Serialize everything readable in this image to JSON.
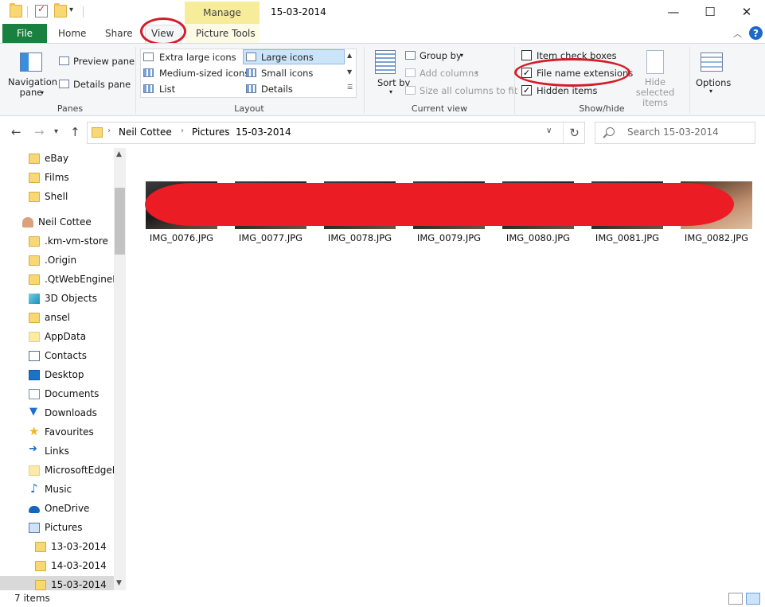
{
  "window": {
    "title": "15-03-2014",
    "contextual_tab_group": "Manage",
    "minimize_glyph": "—",
    "maximize_glyph": "☐",
    "close_glyph": "✕"
  },
  "ribbon_tabs": {
    "file": "File",
    "home": "Home",
    "share": "Share",
    "view": "View",
    "picture_tools": "Picture Tools",
    "active": "View"
  },
  "ribbon": {
    "panes": {
      "label": "Panes",
      "navigation_pane": "Navigation pane",
      "preview_pane": "Preview pane",
      "details_pane": "Details pane"
    },
    "layout": {
      "label": "Layout",
      "options": [
        "Extra large icons",
        "Large icons",
        "Medium-sized icons",
        "Small icons",
        "List",
        "Details"
      ],
      "selected": "Large icons"
    },
    "current_view": {
      "label": "Current view",
      "sort_by": "Sort by",
      "group_by": "Group by",
      "add_columns": "Add columns",
      "size_columns": "Size all columns to fit"
    },
    "show_hide": {
      "label": "Show/hide",
      "item_check_boxes": {
        "label": "Item check boxes",
        "checked": false
      },
      "file_name_extensions": {
        "label": "File name extensions",
        "checked": true
      },
      "hidden_items": {
        "label": "Hidden items",
        "checked": true
      },
      "hide_selected": "Hide selected items"
    },
    "options": "Options"
  },
  "address_bar": {
    "breadcrumbs": [
      "Neil Cottee",
      "Pictures",
      "15-03-2014"
    ],
    "search_placeholder": "Search 15-03-2014"
  },
  "nav_pane": {
    "items": [
      {
        "label": "eBay",
        "icon": "folder-icon",
        "indent": 1
      },
      {
        "label": "Films",
        "icon": "folder-icon",
        "indent": 1
      },
      {
        "label": "Shell",
        "icon": "folder-icon",
        "indent": 1
      },
      {
        "label": "Neil Cottee",
        "icon": "user-icon",
        "indent": 0
      },
      {
        "label": ".km-vm-store",
        "icon": "folder-icon",
        "indent": 1
      },
      {
        "label": ".Origin",
        "icon": "folder-icon",
        "indent": 1
      },
      {
        "label": ".QtWebEnginePr",
        "icon": "folder-icon",
        "indent": 1
      },
      {
        "label": "3D Objects",
        "icon": "3d-objects-icon",
        "indent": 1
      },
      {
        "label": "ansel",
        "icon": "folder-icon",
        "indent": 1
      },
      {
        "label": "AppData",
        "icon": "folder-pale-icon",
        "indent": 1
      },
      {
        "label": "Contacts",
        "icon": "contacts-icon",
        "indent": 1
      },
      {
        "label": "Desktop",
        "icon": "desktop-icon",
        "indent": 1
      },
      {
        "label": "Documents",
        "icon": "documents-icon",
        "indent": 1
      },
      {
        "label": "Downloads",
        "icon": "downloads-icon",
        "indent": 1
      },
      {
        "label": "Favourites",
        "icon": "star-icon",
        "indent": 1
      },
      {
        "label": "Links",
        "icon": "links-icon",
        "indent": 1
      },
      {
        "label": "MicrosoftEdgeBa",
        "icon": "folder-pale-icon",
        "indent": 1
      },
      {
        "label": "Music",
        "icon": "music-icon",
        "indent": 1
      },
      {
        "label": "OneDrive",
        "icon": "onedrive-icon",
        "indent": 1
      },
      {
        "label": "Pictures",
        "icon": "pictures-icon",
        "indent": 1
      },
      {
        "label": "13-03-2014",
        "icon": "folder-icon",
        "indent": 2
      },
      {
        "label": "14-03-2014",
        "icon": "folder-icon",
        "indent": 2
      },
      {
        "label": "15-03-2014",
        "icon": "folder-icon",
        "indent": 2,
        "selected": true
      }
    ]
  },
  "files": [
    "IMG_0076.JPG",
    "IMG_0077.JPG",
    "IMG_0078.JPG",
    "IMG_0079.JPG",
    "IMG_0080.JPG",
    "IMG_0081.JPG",
    "IMG_0082.JPG"
  ],
  "status": {
    "item_count": "7 items"
  },
  "colors": {
    "file_tab": "#19803f",
    "manage_band": "#f7ec9a",
    "annotation_red": "#d41c2a",
    "redaction_red": "#ec1c24",
    "selection_blue": "#cce4f7"
  }
}
